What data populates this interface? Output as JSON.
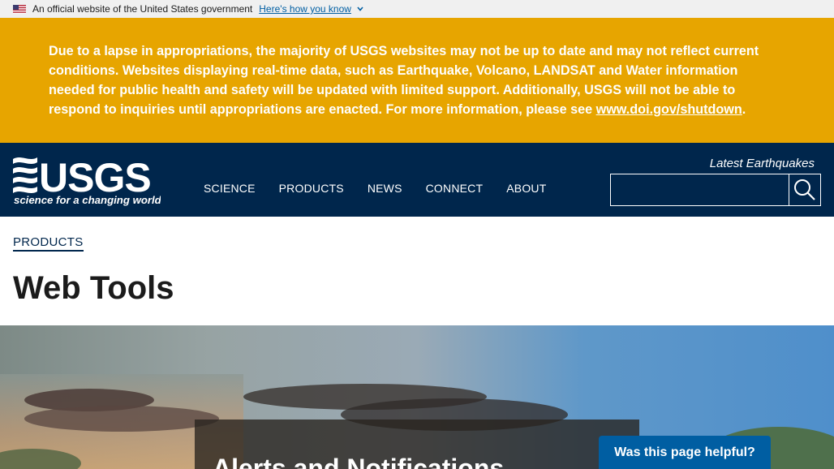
{
  "gov_banner": {
    "text": "An official website of the United States government",
    "link_text": "Here's how you know"
  },
  "alert": {
    "text": "Due to a lapse in appropriations, the majority of USGS websites may not be up to date and may not reflect current conditions. Websites displaying real-time data, such as Earthquake, Volcano, LANDSAT and Water information needed for public health and safety will be updated with limited support. Additionally, USGS will not be able to respond to inquiries until appropriations are enacted. For more information, please see ",
    "link_text": "www.doi.gov/shutdown",
    "suffix": "."
  },
  "header": {
    "logo_text": "USGS",
    "logo_tagline": "science for a changing world",
    "nav": [
      "SCIENCE",
      "PRODUCTS",
      "NEWS",
      "CONNECT",
      "ABOUT"
    ],
    "latest_link": "Latest Earthquakes",
    "search_placeholder": ""
  },
  "breadcrumb": "PRODUCTS",
  "page_title": "Web Tools",
  "hero": {
    "card_title": "Alerts and Notifications"
  },
  "feedback_button": "Was this page helpful?",
  "colors": {
    "alert_bg": "#e7a500",
    "header_bg": "#00264c",
    "feedback_bg": "#005ea2",
    "link_blue": "#005ea2"
  }
}
